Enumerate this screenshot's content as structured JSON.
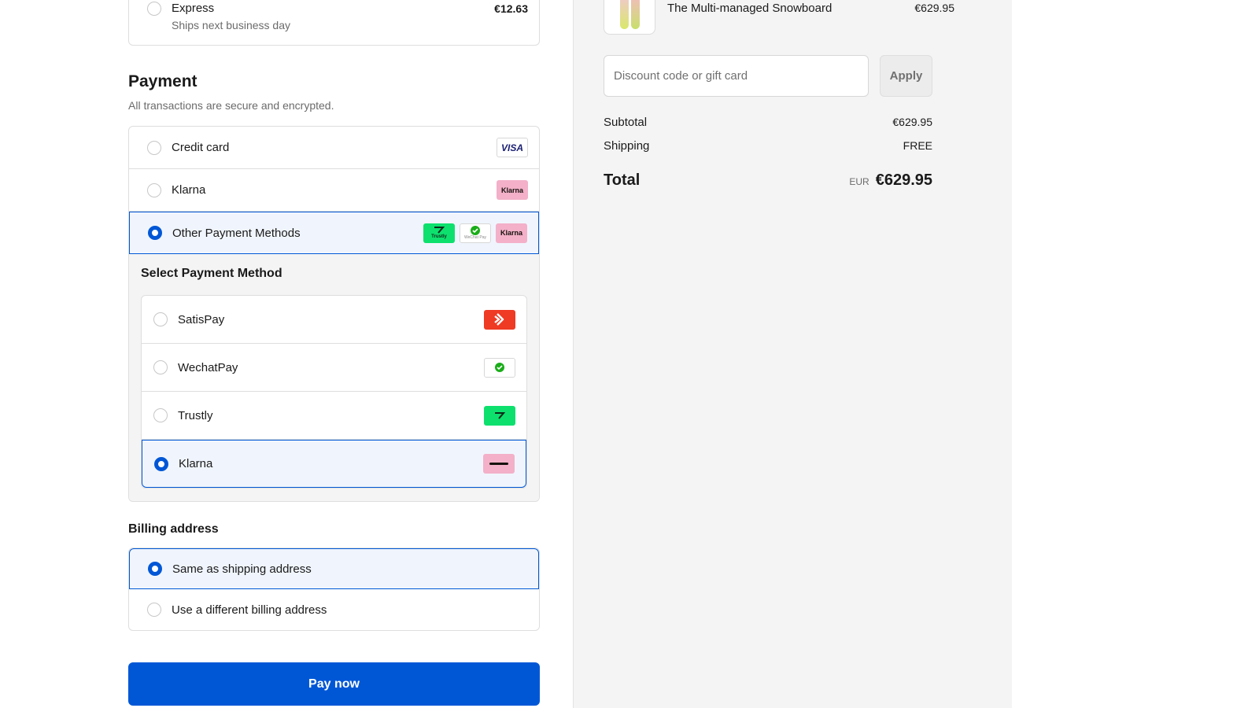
{
  "shipping": {
    "option_name": "Express",
    "option_sub": "Ships next business day",
    "option_price": "€12.63"
  },
  "payment": {
    "title": "Payment",
    "subtitle": "All transactions are secure and encrypted.",
    "methods": [
      {
        "label": "Credit card",
        "badge": "VISA",
        "selected": false
      },
      {
        "label": "Klarna",
        "badge": "Klarna",
        "selected": false
      },
      {
        "label": "Other Payment Methods",
        "badges": [
          "Trustly",
          "WeChat Pay",
          "Klarna"
        ],
        "selected": true
      }
    ],
    "sub_title": "Select Payment Method",
    "sub_methods": [
      {
        "label": "SatisPay",
        "badge": "satispay-logo",
        "selected": false
      },
      {
        "label": "WechatPay",
        "badge": "wechat-pay-logo",
        "selected": false
      },
      {
        "label": "Trustly",
        "badge": "trustly-logo",
        "selected": false
      },
      {
        "label": "Klarna",
        "badge": "klarna-logo",
        "selected": true
      }
    ]
  },
  "billing": {
    "title": "Billing address",
    "options": [
      {
        "label": "Same as shipping address",
        "selected": true
      },
      {
        "label": "Use a different billing address",
        "selected": false
      }
    ]
  },
  "pay_button": "Pay now",
  "summary": {
    "item_name": "The Multi-managed Snowboard",
    "item_price": "€629.95",
    "discount_placeholder": "Discount code or gift card",
    "apply_label": "Apply",
    "subtotal_label": "Subtotal",
    "subtotal_value": "€629.95",
    "shipping_label": "Shipping",
    "shipping_value": "FREE",
    "total_label": "Total",
    "currency": "EUR",
    "total_value": "€629.95"
  },
  "colors": {
    "accent": "#0057d6",
    "selected_bg": "#f0f5fd",
    "summary_bg": "#f4f4f4",
    "klarna": "#f3b0c8",
    "trustly": "#0ee06e",
    "satispay": "#ef3a24"
  }
}
